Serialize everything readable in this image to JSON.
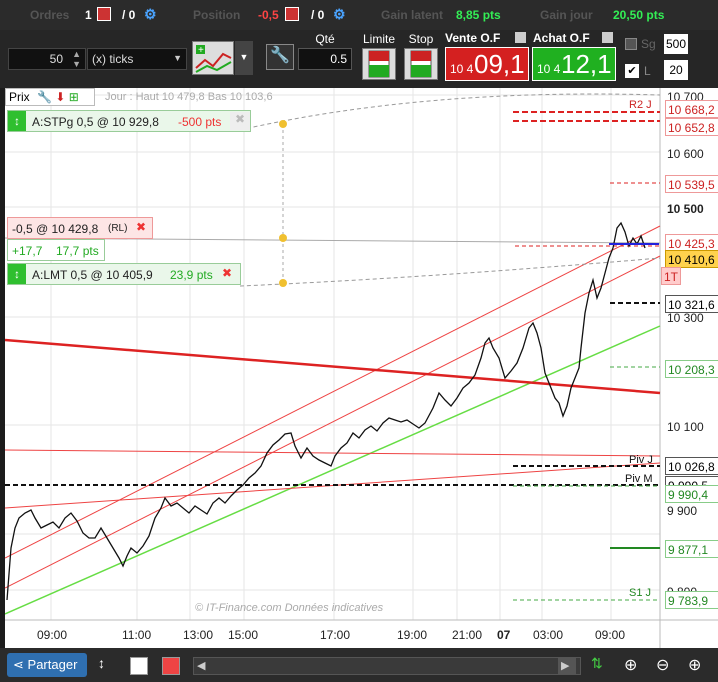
{
  "top": {
    "orders_label": "Ordres",
    "orders_val": "1",
    "orders_sep": "/ 0",
    "position_label": "Position",
    "position_val": "-0,5",
    "position_sep": "/ 0",
    "pl_label": "Gain latent",
    "pl_val": "8,85 pts",
    "pl2_label": "Gain jour",
    "pl2_val": "20,50 pts"
  },
  "toolbar": {
    "step_value": "50",
    "step_unit": "(x) ticks",
    "qty_label": "Qté",
    "qty_value": "0.5",
    "limit_label": "Limite",
    "stop_label": "Stop",
    "sell_label": "Vente O.F",
    "sell_small": "10 4",
    "sell_big": "09,1",
    "buy_label": "Achat O.F",
    "buy_small": "10 4",
    "buy_big": "12,1",
    "right_500": "500",
    "right_20": "20",
    "right_l": "L",
    "right_sg": "Sg"
  },
  "chart": {
    "prix_label": "Prix",
    "day_info": "Jour : Haut 10 479,8 Bas 10 103,6",
    "watermark": "© IT-Finance.com  Données indicatives",
    "orders": {
      "stp": "A:STPg  0,5 @ 10 929,8",
      "stp_pts": "-500 pts",
      "pos": "-0,5 @ 10 429,8",
      "pos_rl": "(RL)",
      "pos_pl1": "+17,7",
      "pos_pl2": "17,7 pts",
      "lmt": "A:LMT  0,5 @ 10 405,9",
      "lmt_pts": "23,9 pts"
    },
    "level_labels": {
      "r2": "R2 J",
      "piv_j": "Piv J",
      "piv_m": "Piv M",
      "s1": "S1 J",
      "one_t": "1T"
    }
  },
  "price_axis": [
    {
      "value": "10 700",
      "kind": "tick"
    },
    {
      "value": "10 668,2",
      "kind": "red"
    },
    {
      "value": "10 652,8",
      "kind": "red"
    },
    {
      "value": "10 600",
      "kind": "tick"
    },
    {
      "value": "10 539,5",
      "kind": "red"
    },
    {
      "value": "10 500",
      "kind": "tickbold"
    },
    {
      "value": "10 425,3",
      "kind": "red"
    },
    {
      "value": "10 410,6",
      "kind": "current"
    },
    {
      "value": "10 321,6",
      "kind": "black"
    },
    {
      "value": "10 300",
      "kind": "tick"
    },
    {
      "value": "10 208,3",
      "kind": "green"
    },
    {
      "value": "10 100",
      "kind": "tick"
    },
    {
      "value": "10 026,8",
      "kind": "black"
    },
    {
      "value": "9 990,5",
      "kind": "black"
    },
    {
      "value": "9 990,4",
      "kind": "green"
    },
    {
      "value": "9 900",
      "kind": "tick"
    },
    {
      "value": "9 877,1",
      "kind": "green"
    },
    {
      "value": "9 800",
      "kind": "tick"
    },
    {
      "value": "9 783,9",
      "kind": "green"
    }
  ],
  "time_axis": [
    "09:00",
    "11:00",
    "13:00",
    "15:00",
    "17:00",
    "19:00",
    "21:00",
    "07",
    "03:00",
    "09:00"
  ],
  "bottom": {
    "share_label": "Partager"
  }
}
